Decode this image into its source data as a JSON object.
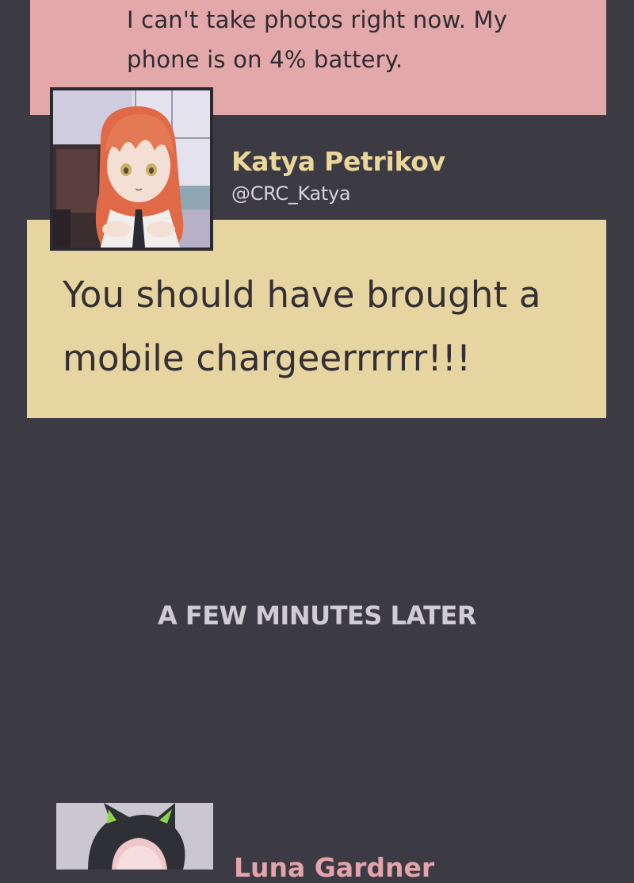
{
  "messages": [
    {
      "text_lines": [
        "I can't take photos right now. My",
        "phone is on 4% battery."
      ],
      "bubble_color": "#e3a9aa"
    },
    {
      "author_name": "Katya Petrikov",
      "author_handle": "@CRC_Katya",
      "text_lines": [
        "You should have brought a",
        "mobile chargeerrrrrr!!!"
      ],
      "bubble_color": "#e6d4a1",
      "name_color": "#ecd79b"
    }
  ],
  "caption": "A FEW MINUTES LATER",
  "next_author": {
    "name": "Luna Gardner",
    "name_color": "#e3a4ab"
  },
  "colors": {
    "background": "#3c3a43"
  }
}
